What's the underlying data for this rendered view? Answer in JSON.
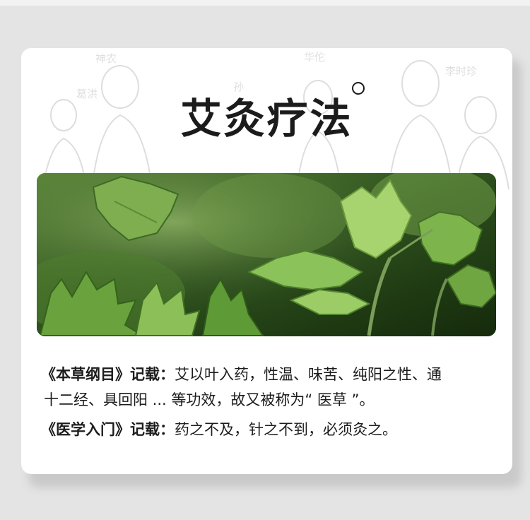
{
  "title": "艾灸疗法",
  "background_calligraphy": [
    "神农",
    "葛洪",
    "孙",
    "华佗",
    "李时珍"
  ],
  "records": [
    {
      "source": "《本草纲目》记载：",
      "line1": "艾以叶入药，性温、味苦、纯阳之性、通",
      "line2": "十二经、具回阳 ... 等功效，故又被称为“ 医草 ”。"
    },
    {
      "source": "《医学入门》记载：",
      "line1": "药之不及，针之不到，必须灸之。"
    }
  ],
  "colors": {
    "page_bg": "#e4e4e4",
    "card_bg": "#ffffff",
    "text": "#1c1c1c",
    "leaf_light": "#8fc35a",
    "leaf_dark": "#2f5a1c"
  },
  "image": "mugwort-leaves-photo"
}
